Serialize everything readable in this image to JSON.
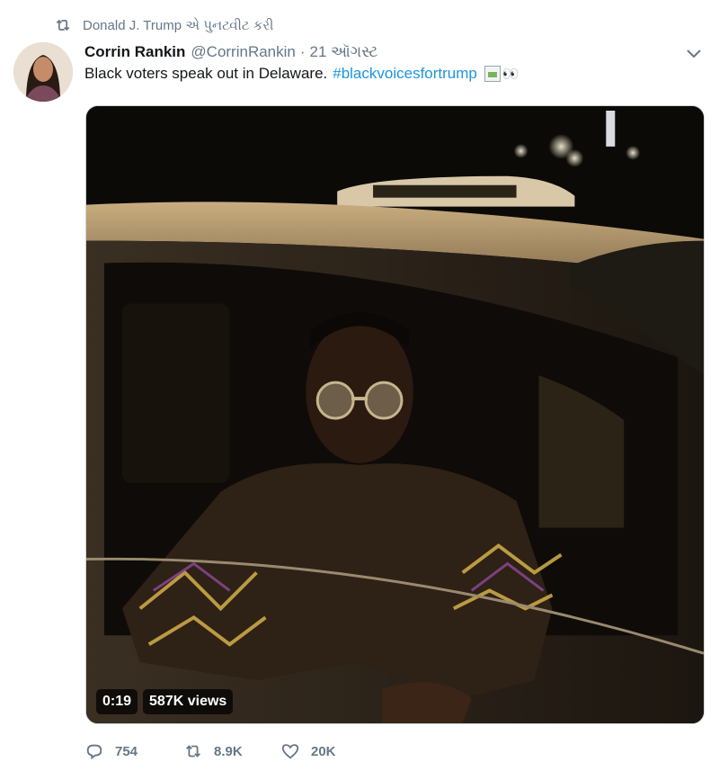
{
  "retweet": {
    "icon": "retweet-icon",
    "text": "Donald J. Trump એ પુનટ્વીટ કરી"
  },
  "tweet": {
    "avatar_icon": "avatar-photo",
    "author_name": "Corrin Rankin",
    "author_handle": "@CorrinRankin",
    "separator": "·",
    "date": "21 ઑગસ્ટ",
    "text": "Black voters speak out in Delaware.",
    "hashtag": "#blackvoicesfortrump",
    "emoji": "👀",
    "menu_icon": "chevron-down-icon"
  },
  "video": {
    "duration": "0:19",
    "views": "587K views"
  },
  "actions": {
    "reply": {
      "icon": "reply-icon",
      "count": "754"
    },
    "retweet": {
      "icon": "retweet-icon",
      "count": "8.9K"
    },
    "like": {
      "icon": "heart-icon",
      "count": "20K"
    }
  },
  "colors": {
    "link": "#1b95e0",
    "secondary": "#657786",
    "text": "#14171a"
  }
}
